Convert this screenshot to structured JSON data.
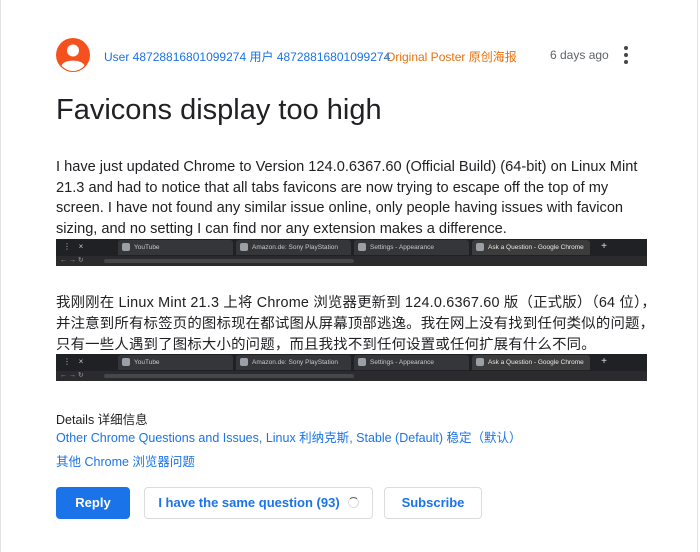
{
  "post": {
    "author": "User 48728816801099274 用户 48728816801099274",
    "badge": "Original Poster 原创海报",
    "time": "6 days ago",
    "title": "Favicons display too high",
    "body_en": "I have just updated Chrome to Version 124.0.6367.60 (Official Build) (64-bit) on Linux Mint 21.3 and had to notice that all tabs favicons are now trying to escape off the top of my screen. I have not found any similar issue online, only people having issues with favicon sizing, and no setting I can find nor any extension makes a difference.",
    "body_zh": "我刚刚在 Linux Mint 21.3 上将 Chrome 浏览器更新到 124.0.6367.60 版（正式版）（64 位），并注意到所有标签页的图标现在都试图从屏幕顶部逃逸。我在网上没有找到任何类似的问题，只有一些人遇到了图标大小的问题，而且我找不到任何设置或任何扩展有什么不同。"
  },
  "screenshot_tabs": [
    {
      "label": "YouTube"
    },
    {
      "label": "Amazon.de: Sony PlayStation"
    },
    {
      "label": "Settings - Appearance"
    },
    {
      "label": "Ask a Question - Google Chrome"
    }
  ],
  "details": {
    "label": "Details 详细信息",
    "link1": "Other Chrome Questions and Issues",
    "sep1": ", ",
    "link2": "Linux 利纳克斯",
    "sep2": ", ",
    "link3": "Stable (Default) 稳定（默认）",
    "extra": "其他 Chrome 浏览器问题"
  },
  "actions": {
    "reply": "Reply",
    "same_question": "I have the same question (93)",
    "subscribe": "Subscribe"
  },
  "colors": {
    "accent": "#1a73e8",
    "avatar": "#f4511e",
    "badge": "#e8710a"
  },
  "icons": {
    "avatar": "person-avatar-icon",
    "more": "more-vert-icon",
    "spinner": "loading-spinner-icon"
  }
}
